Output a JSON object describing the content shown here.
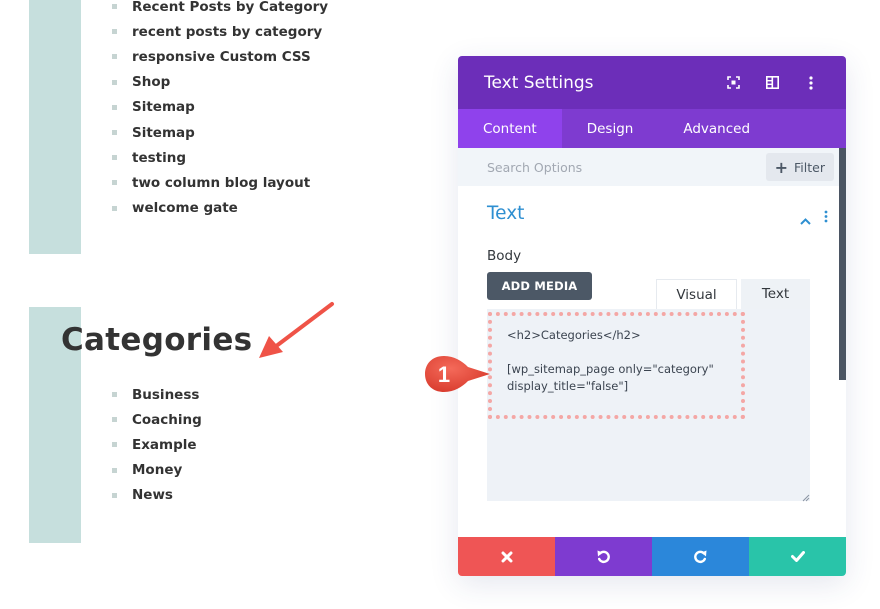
{
  "page": {
    "top_list": [
      "Recent Posts by Category",
      "recent posts by category",
      "responsive Custom CSS",
      "Shop",
      "Sitemap",
      "Sitemap",
      "testing",
      "two column blog layout",
      "welcome gate"
    ],
    "categories_heading": "Categories",
    "categories_list": [
      "Business",
      "Coaching",
      "Example",
      "Money",
      "News"
    ]
  },
  "modal": {
    "title": "Text Settings",
    "header_icons": [
      "fullscreen-icon",
      "split-view-icon",
      "more-options-icon"
    ],
    "tabs": [
      {
        "label": "Content",
        "active": true
      },
      {
        "label": "Design",
        "active": false
      },
      {
        "label": "Advanced",
        "active": false
      }
    ],
    "search": {
      "placeholder": "Search Options",
      "value": ""
    },
    "filter_label": "Filter",
    "section": {
      "title": "Text",
      "body_label": "Body",
      "add_media_label": "ADD MEDIA",
      "editor_tabs": [
        {
          "label": "Visual",
          "active": false
        },
        {
          "label": "Text",
          "active": true
        }
      ],
      "editor_content": "<h2>Categories</h2>\n\n[wp_sitemap_page only=\"category\"\ndisplay_title=\"false\"]"
    },
    "footer": {
      "buttons": [
        "cancel",
        "undo",
        "redo",
        "save"
      ]
    }
  },
  "annotation": {
    "badge_number": "1"
  },
  "colors": {
    "header_purple": "#6c2eb9",
    "tab_purple": "#7e3bd0",
    "active_tab": "#8f42ec",
    "accent_blue": "#2e8fd1",
    "cancel_red": "#ef5555",
    "redo_blue": "#2b87da",
    "save_green": "#29c4a9",
    "teal_block": "#c6dfdd",
    "annotation_red": "#ef5347"
  }
}
